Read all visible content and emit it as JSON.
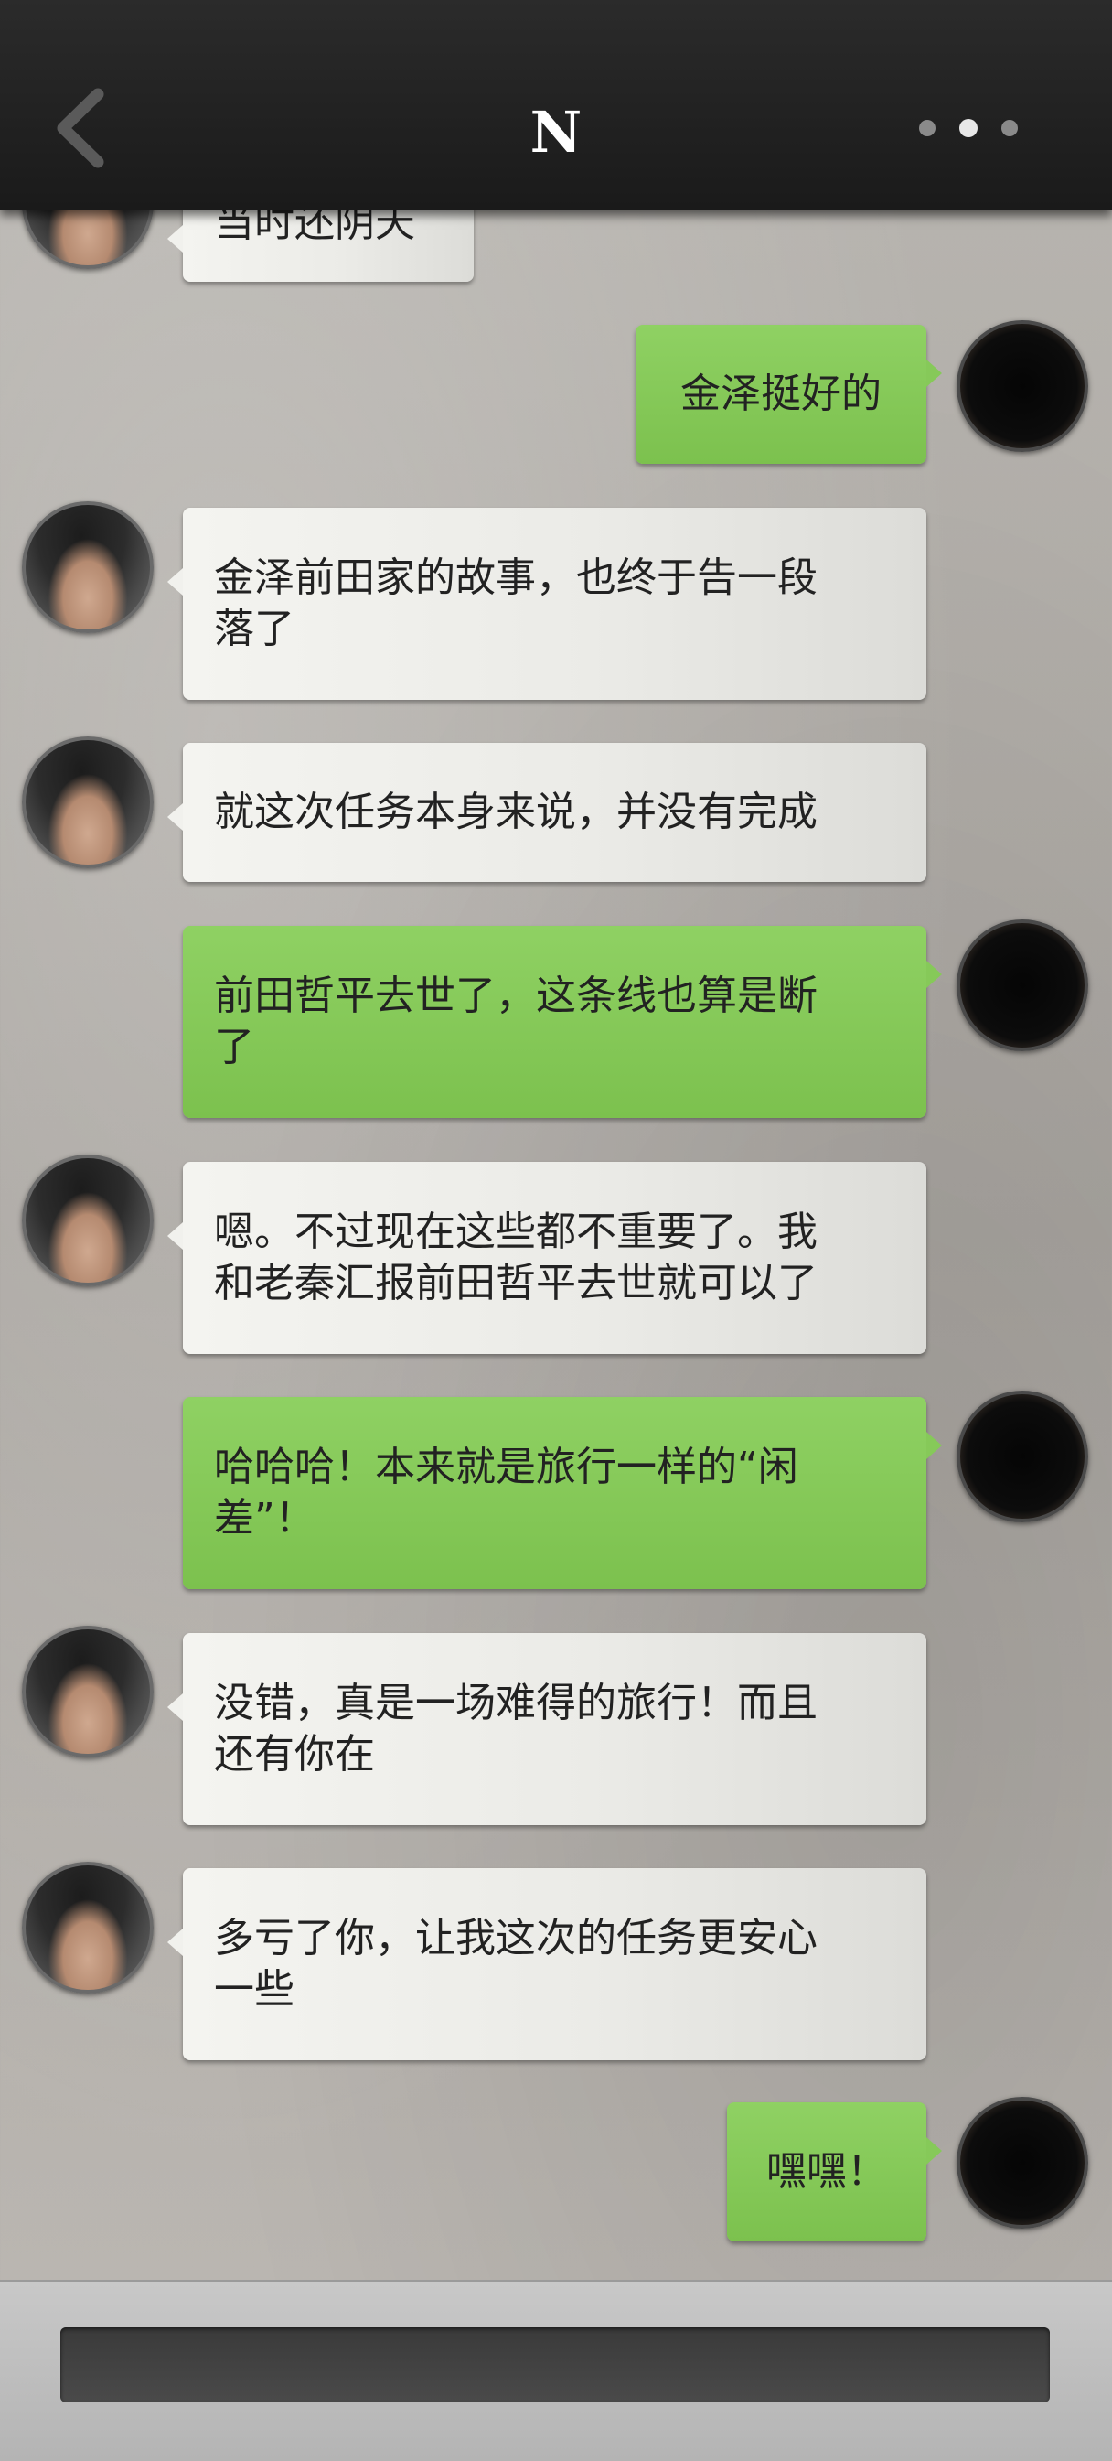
{
  "header": {
    "title": "N",
    "back_icon": "chevron-left-icon",
    "more_icon": "more-dots-icon"
  },
  "messages": [
    {
      "side": "in",
      "lines": [
        "当时还阴天"
      ]
    },
    {
      "side": "out",
      "lines": [
        "金泽挺好的"
      ]
    },
    {
      "side": "in",
      "lines": [
        "金泽前田家的故事，也终于告一段",
        "落了"
      ]
    },
    {
      "side": "in",
      "lines": [
        "就这次任务本身来说，并没有完成"
      ]
    },
    {
      "side": "out",
      "lines": [
        "前田哲平去世了，这条线也算是断",
        "了"
      ]
    },
    {
      "side": "in",
      "lines": [
        "嗯。不过现在这些都不重要了。我",
        "和老秦汇报前田哲平去世就可以了"
      ]
    },
    {
      "side": "out",
      "lines": [
        "哈哈哈！本来就是旅行一样的“闲",
        "差”！"
      ]
    },
    {
      "side": "in",
      "lines": [
        "没错，真是一场难得的旅行！而且",
        "还有你在"
      ]
    },
    {
      "side": "in",
      "lines": [
        "多亏了你，让我这次的任务更安心",
        "一些"
      ]
    },
    {
      "side": "out",
      "lines": [
        "嘿嘿！"
      ]
    }
  ],
  "colors": {
    "header_bg": "#1f1f1f",
    "incoming_bubble": "#ececE8",
    "outgoing_bubble": "#86c959",
    "input_bar": "#404040"
  }
}
